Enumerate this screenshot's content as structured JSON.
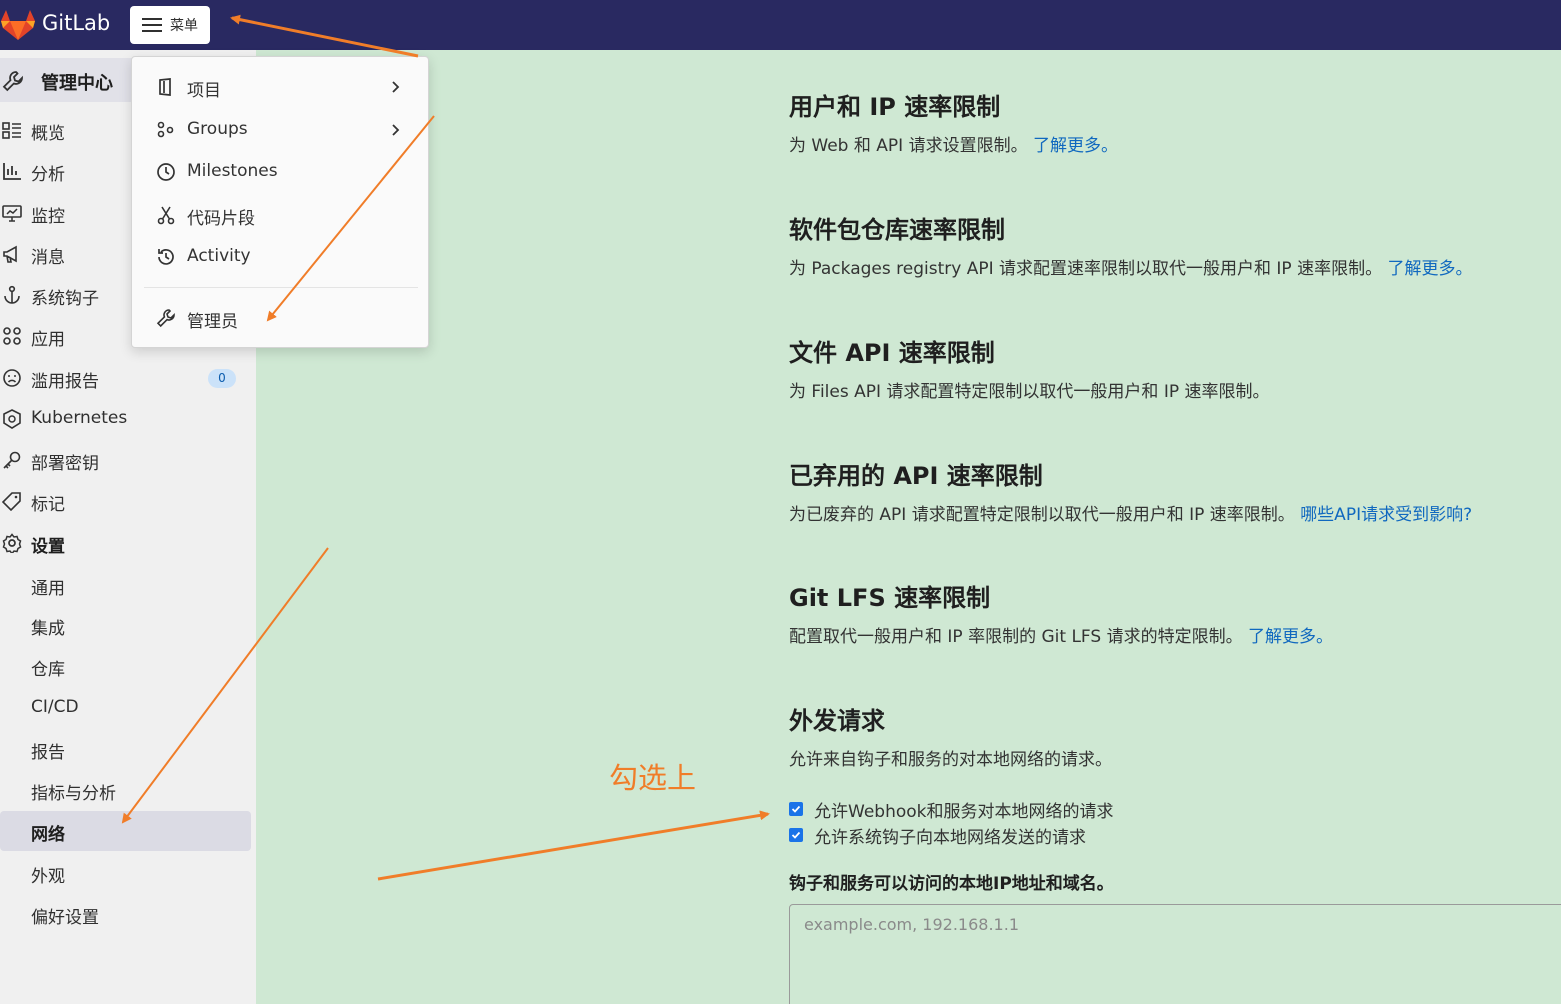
{
  "topbar": {
    "brand": "GitLab",
    "menu_label": "菜单"
  },
  "sidebar": {
    "header": "管理中心",
    "items": [
      {
        "label": "概览",
        "icon": "overview-icon"
      },
      {
        "label": "分析",
        "icon": "chart-icon"
      },
      {
        "label": "监控",
        "icon": "monitor-icon"
      },
      {
        "label": "消息",
        "icon": "megaphone-icon"
      },
      {
        "label": "系统钩子",
        "icon": "anchor-icon"
      },
      {
        "label": "应用",
        "icon": "apps-icon"
      },
      {
        "label": "滥用报告",
        "icon": "abuse-face-icon",
        "badge": "0"
      },
      {
        "label": "Kubernetes",
        "icon": "kubernetes-icon"
      },
      {
        "label": "部署密钥",
        "icon": "key-icon"
      },
      {
        "label": "标记",
        "icon": "label-icon"
      },
      {
        "label": "设置",
        "icon": "settings-icon"
      }
    ],
    "settings_items": [
      "通用",
      "集成",
      "仓库",
      "CI/CD",
      "报告",
      "指标与分析",
      "网络",
      "外观",
      "偏好设置"
    ],
    "active_item": "网络"
  },
  "dropdown": {
    "items": [
      {
        "label": "项目",
        "icon": "project-icon"
      },
      {
        "label": "Groups",
        "icon": "group-icon"
      },
      {
        "label": "Milestones",
        "icon": "clock-icon"
      },
      {
        "label": "代码片段",
        "icon": "scissors-icon"
      },
      {
        "label": "Activity",
        "icon": "history-icon"
      },
      {
        "label": "管理员",
        "icon": "admin-wrench-icon"
      }
    ]
  },
  "sections": [
    {
      "title": "用户和 IP 速率限制",
      "desc": "为 Web 和 API 请求设置限制。",
      "link": "了解更多。"
    },
    {
      "title": "软件包仓库速率限制",
      "desc": "为 Packages registry API 请求配置速率限制以取代一般用户和 IP 速率限制。",
      "link": "了解更多。"
    },
    {
      "title": "文件 API 速率限制",
      "desc": "为 Files API 请求配置特定限制以取代一般用户和 IP 速率限制。",
      "link": ""
    },
    {
      "title": "已弃用的 API 速率限制",
      "desc": "为已废弃的 API 请求配置特定限制以取代一般用户和 IP 速率限制。",
      "link": "哪些API请求受到影响?"
    },
    {
      "title": "Git LFS 速率限制",
      "desc": "配置取代一般用户和 IP 率限制的 Git LFS 请求的特定限制。",
      "link": "了解更多。"
    },
    {
      "title": "外发请求",
      "desc": "允许来自钩子和服务的对本地网络的请求。",
      "link": ""
    }
  ],
  "outbound": {
    "checkbox1": "允许Webhook和服务对本地网络的请求",
    "checkbox2": "允许系统钩子向本地网络发送的请求",
    "checkbox1_checked": true,
    "checkbox2_checked": true,
    "allowlist_label": "钩子和服务可以访问的本地IP地址和域名。",
    "allowlist_placeholder": "example.com, 192.168.1.1"
  },
  "annotation": "勾选上",
  "colors": {
    "topbar": "#292961",
    "accent_link": "#1068bf",
    "annotation": "#f07d29",
    "background": "#cfe8d3"
  }
}
